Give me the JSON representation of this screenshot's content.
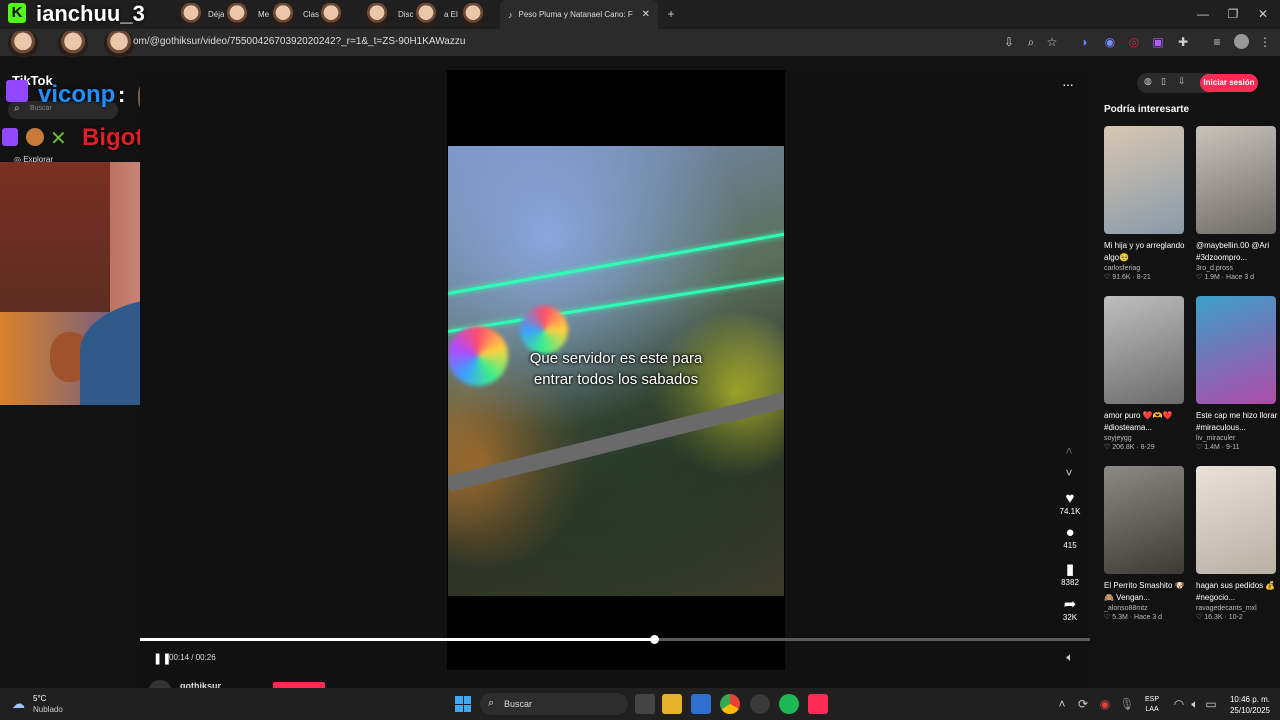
{
  "browser": {
    "tabs": [
      {
        "label": "ianchuu_3",
        "kind": "streamer-name"
      },
      {
        "label": "e..."
      },
      {
        "label": "Déja"
      },
      {
        "label": "Me"
      },
      {
        "label": "Clas"
      },
      {
        "label": "Disc"
      },
      {
        "label": "a El"
      },
      {
        "label": "Peso Pluma y Natanael Cano: F",
        "active": true
      }
    ],
    "url": "om/@gothiksur/video/7550042670392020242?_r=1&_t=ZS-90H1KAWazzu",
    "new_tab": "+"
  },
  "tiktok": {
    "brand": "TikTok",
    "search_placeholder": "Buscar",
    "nav_explore": "Explorar",
    "login_button": "Iniciar sesión",
    "more": "···"
  },
  "overlay_chat": {
    "line1_user": "viconp",
    "line1_sep": ":",
    "line2_user": "Bigotes_Simio",
    "line2_sep": ":"
  },
  "video": {
    "caption_line1": "Que servidor es este para",
    "caption_line2": "entrar todos los sabados",
    "time": "00:14 / 00:26",
    "progress": 0.54,
    "author": "gothiksur"
  },
  "actions": {
    "likes": "74.1K",
    "comments": "415",
    "saves": "8382",
    "shares": "32K"
  },
  "recommend": {
    "title": "Podría interesarte",
    "items": [
      {
        "title": "Mi hija y yo arreglando algo🥺",
        "author": "carlosferiag",
        "likes": "91.6K",
        "date": "8-21",
        "c1": "#d7c7b3",
        "c2": "#8a9aa8"
      },
      {
        "title": "@maybellin.00 @Ari #3dzoompro...",
        "author": "3ro_d.pross",
        "likes": "1.9M",
        "date": "Hace 3 d",
        "c1": "#c9c3bc",
        "c2": "#6e6a66"
      },
      {
        "title": "amor puro ❤️🫶❤️ #diosteama...",
        "author": "soyjeygg",
        "likes": "206.8K",
        "date": "8-29",
        "c1": "#bfbfbf",
        "c2": "#6b6b6b"
      },
      {
        "title": "Este cap me hizo llorar #miraculous...",
        "author": "liv_miraculer",
        "likes": "1.4M",
        "date": "9-11",
        "c1": "#3aa0c8",
        "c2": "#b04aa8"
      },
      {
        "title": "El Perrito Smashito 🐶🙈 Vengan...",
        "author": "_alonso88mtz",
        "likes": "5.3M",
        "date": "Hace 3 d",
        "c1": "#8c8a85",
        "c2": "#3d3a36"
      },
      {
        "title": "hagan sus pedidos 💰 #negocio...",
        "author": "ravagedecants_mxl",
        "likes": "16.3K",
        "date": "10-2",
        "c1": "#e9e2d8",
        "c2": "#b8b0a3"
      }
    ]
  },
  "taskbar": {
    "weather_temp": "5°C",
    "weather_desc": "Nublado",
    "search": "Buscar",
    "lang1": "ESP",
    "lang2": "LAA",
    "time": "10:46 p. m.",
    "date": "25/10/2025"
  },
  "colors": {
    "accent": "#fe2c55",
    "twitch": "#9146ff",
    "laser": "#2fffb5"
  }
}
